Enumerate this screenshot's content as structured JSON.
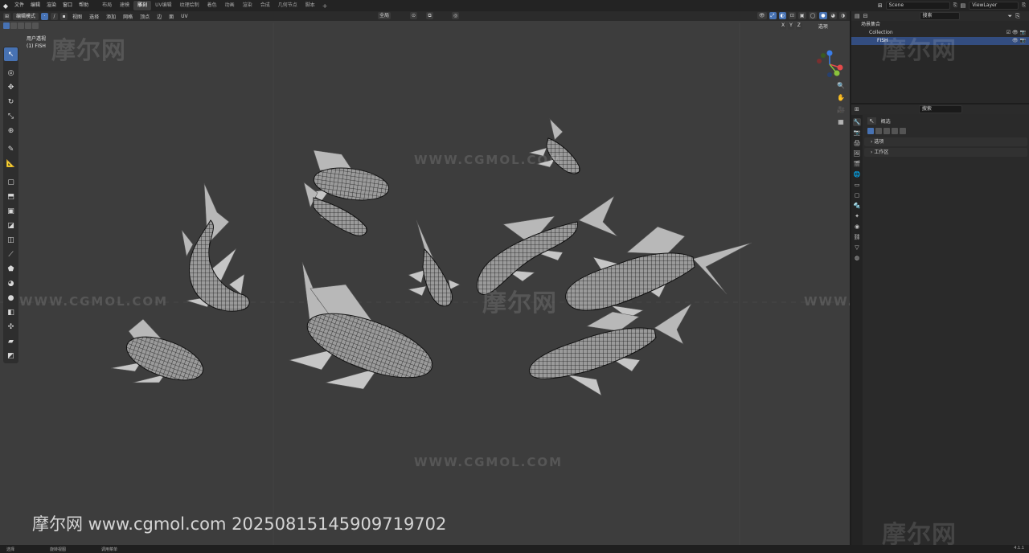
{
  "topbar": {
    "logo_glyph": "◆",
    "menus": [
      "文件",
      "编辑",
      "渲染",
      "窗口",
      "帮助"
    ],
    "workspaces": [
      "布局",
      "建模",
      "雕刻",
      "UV编辑",
      "纹理绘制",
      "着色",
      "动画",
      "渲染",
      "合成",
      "几何节点",
      "脚本"
    ],
    "active_workspace_index": 2,
    "add_tab": "+",
    "scene_name": "Scene",
    "view_layer": "ViewLayer"
  },
  "viewport_header": {
    "mode": "编辑模式",
    "menus": [
      "视图",
      "选择",
      "添加",
      "网格",
      "顶点",
      "边",
      "面",
      "UV"
    ],
    "transform_orientation": "全局",
    "options_label": "选项",
    "xyz": [
      "X",
      "Y",
      "Z"
    ]
  },
  "viewport_overlay": {
    "view_name": "用户透视",
    "object_name": "(1) FISH"
  },
  "toolbar": {
    "tools": [
      {
        "name": "select-box-tool",
        "glyph": "↖"
      },
      {
        "name": "cursor-tool",
        "glyph": "◎"
      },
      {
        "name": "move-tool",
        "glyph": "✥"
      },
      {
        "name": "rotate-tool",
        "glyph": "↻"
      },
      {
        "name": "scale-tool",
        "glyph": "⤡"
      },
      {
        "name": "transform-tool",
        "glyph": "⊕"
      },
      {
        "name": "annotate-tool",
        "glyph": "✎"
      },
      {
        "name": "measure-tool",
        "glyph": "📐"
      },
      {
        "name": "add-cube-tool",
        "glyph": "▢"
      },
      {
        "name": "extrude-tool",
        "glyph": "⬒"
      },
      {
        "name": "inset-tool",
        "glyph": "▣"
      },
      {
        "name": "bevel-tool",
        "glyph": "◪"
      },
      {
        "name": "loop-cut-tool",
        "glyph": "◫"
      },
      {
        "name": "knife-tool",
        "glyph": "⟋"
      },
      {
        "name": "poly-build-tool",
        "glyph": "⬟"
      },
      {
        "name": "spin-tool",
        "glyph": "◕"
      },
      {
        "name": "smooth-tool",
        "glyph": "●"
      },
      {
        "name": "edge-slide-tool",
        "glyph": "◧"
      },
      {
        "name": "shrink-fatten-tool",
        "glyph": "✣"
      },
      {
        "name": "shear-tool",
        "glyph": "▰"
      },
      {
        "name": "rip-tool",
        "glyph": "◩"
      }
    ],
    "active_index": 0
  },
  "watermarks": {
    "url": "WWW.CGMOL.COM",
    "cn": "摩尔网",
    "bottom_text": "摩尔网 www.cgmol.com 20250815145909719702"
  },
  "statusbar": {
    "items": [
      "选择",
      "旋转视图",
      "调用菜单"
    ],
    "version": "4.1.1"
  },
  "outliner": {
    "search_placeholder": "搜索",
    "root": "场景集合",
    "collection": "Collection",
    "object": "FISH"
  },
  "properties": {
    "search_placeholder": "搜索",
    "title": "概选",
    "sections": [
      "选项",
      "工作区"
    ]
  },
  "colors": {
    "accent": "#4772b3",
    "viewport_bg": "#3d3d3d",
    "fish_fill": "#8a8a8a",
    "fin_fill": "#c4c4c4",
    "gizmo_x": "#e34a4a",
    "gizmo_y": "#8ac33c",
    "gizmo_z": "#3a7de8"
  }
}
